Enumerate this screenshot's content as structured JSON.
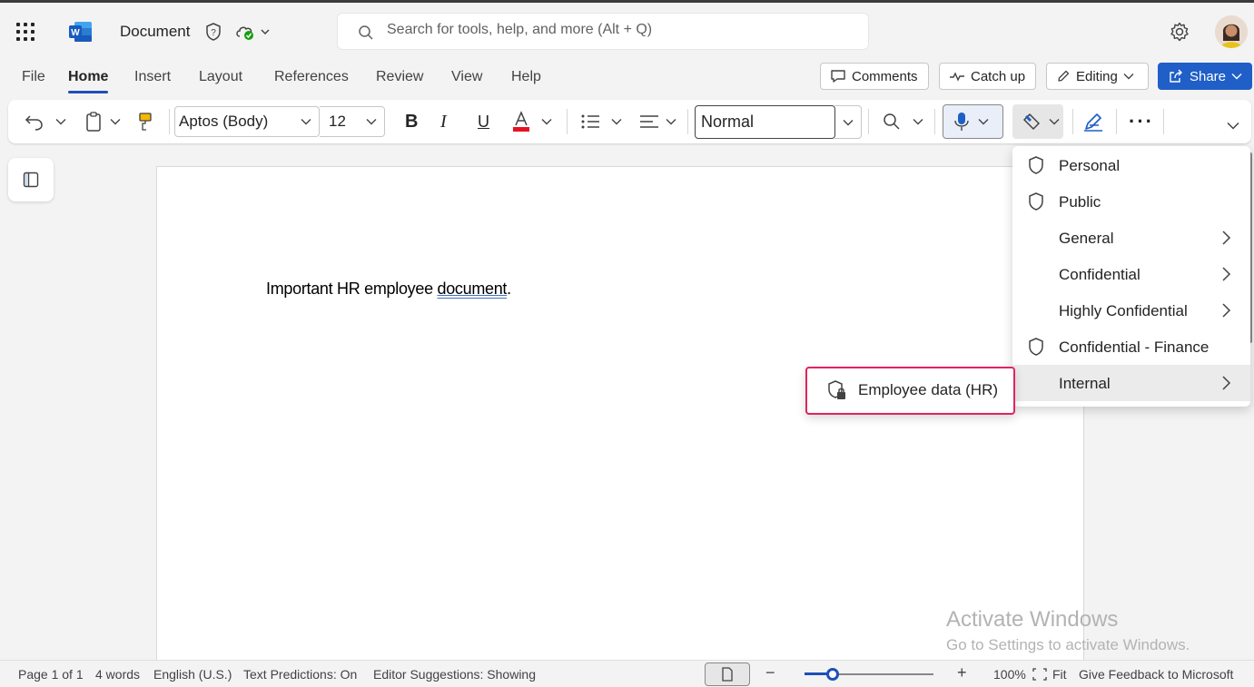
{
  "app": {
    "doc_title": "Document",
    "search_placeholder": "Search for tools, help, and more (Alt + Q)"
  },
  "menu": {
    "tabs": [
      "File",
      "Home",
      "Insert",
      "Layout",
      "References",
      "Review",
      "View",
      "Help"
    ],
    "active_tab": "Home",
    "comments_label": "Comments",
    "catchup_label": "Catch up",
    "editing_label": "Editing",
    "share_label": "Share"
  },
  "ribbon": {
    "font_name": "Aptos (Body)",
    "font_size": "12",
    "style_value": "Normal",
    "font_color": "#e81123"
  },
  "document": {
    "text_before": "Important HR employee ",
    "text_underlined": "document",
    "text_after": "."
  },
  "sensitivity_menu": {
    "items": [
      {
        "label": "Personal",
        "icon": "shield-icon",
        "submenu": false
      },
      {
        "label": "Public",
        "icon": "shield-icon",
        "submenu": false
      },
      {
        "label": "General",
        "icon": "",
        "submenu": true
      },
      {
        "label": "Confidential",
        "icon": "",
        "submenu": true
      },
      {
        "label": "Highly Confidential",
        "icon": "",
        "submenu": true
      },
      {
        "label": "Confidential - Finance",
        "icon": "shield-icon",
        "submenu": false
      },
      {
        "label": "Internal",
        "icon": "",
        "submenu": true
      }
    ],
    "submenu_item": "Employee data (HR)"
  },
  "watermark": {
    "line1": "Activate Windows",
    "line2": "Go to Settings to activate Windows."
  },
  "status": {
    "page": "Page 1 of 1",
    "words": "4 words",
    "language": "English (U.S.)",
    "predictions": "Text Predictions: On",
    "editor": "Editor Suggestions: Showing",
    "zoom": "100%",
    "fit": "Fit",
    "feedback": "Give Feedback to Microsoft",
    "zoom_fraction": 0.22
  }
}
